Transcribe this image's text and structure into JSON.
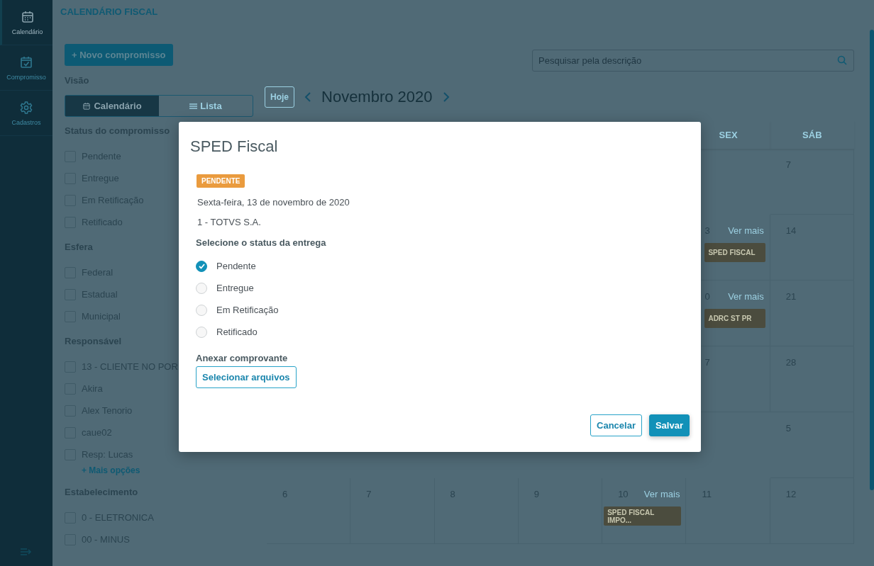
{
  "nav": {
    "items": [
      {
        "label": "Calendário",
        "selected": true
      },
      {
        "label": "Compromisso",
        "selected": false
      },
      {
        "label": "Cadastros",
        "selected": false
      }
    ]
  },
  "header": {
    "title": "CALENDÁRIO FISCAL"
  },
  "filters": {
    "new_button": "+ Novo compromisso",
    "view_label": "Visão",
    "view_options": [
      {
        "label": "Calendário",
        "selected": true
      },
      {
        "label": "Lista",
        "selected": false
      }
    ],
    "sections": [
      {
        "title": "Status do compromisso",
        "options": [
          {
            "label": "Pendente",
            "checked": false
          },
          {
            "label": "Entregue",
            "checked": false
          },
          {
            "label": "Em Retificação",
            "checked": false
          },
          {
            "label": "Retificado",
            "checked": false
          }
        ]
      },
      {
        "title": "Esfera",
        "options": [
          {
            "label": "Federal",
            "checked": false
          },
          {
            "label": "Estadual",
            "checked": false
          },
          {
            "label": "Municipal",
            "checked": false
          }
        ]
      },
      {
        "title": "Responsável",
        "options": [
          {
            "label": "13 - CLIENTE NO POR",
            "checked": false
          },
          {
            "label": "Akira",
            "checked": false
          },
          {
            "label": "Alex Tenorio",
            "checked": false
          },
          {
            "label": "caue02",
            "checked": false
          },
          {
            "label": "Resp: Lucas",
            "checked": false
          }
        ],
        "more": "+ Mais opções"
      },
      {
        "title": "Estabelecimento",
        "options": [
          {
            "label": "0 - ELETRONICA",
            "checked": false
          },
          {
            "label": "00 - MINUS",
            "checked": false
          }
        ]
      }
    ]
  },
  "search": {
    "placeholder": "Pesquisar pela descrição"
  },
  "calendar": {
    "today_button": "Hoje",
    "month": "Novembro 2020",
    "weekdays": [
      "SEX",
      "SÁB"
    ],
    "weeks": [
      {
        "days": [
          {
            "date": "7"
          }
        ]
      },
      {
        "days": [
          {
            "date": "3",
            "more": "Ver mais",
            "events": [
              "SPED FISCAL"
            ]
          },
          {
            "date": "14"
          }
        ]
      },
      {
        "days": [
          {
            "date": "0",
            "more": "Ver mais",
            "events": [
              "ADRC ST PR"
            ]
          },
          {
            "date": "21"
          }
        ]
      },
      {
        "days": [
          {
            "date": "7"
          },
          {
            "date": "28"
          }
        ]
      },
      {
        "days": [
          {
            "date": "5"
          }
        ]
      },
      {
        "days": [
          {
            "date": "6"
          },
          {
            "date": "7"
          },
          {
            "date": "8"
          },
          {
            "date": "9"
          },
          {
            "date": "10",
            "more": "Ver mais",
            "events": [
              "SPED FISCAL IMPO..."
            ]
          },
          {
            "date": "11"
          },
          {
            "date": "12"
          }
        ]
      }
    ]
  },
  "modal": {
    "title": "SPED Fiscal",
    "status_badge": "PENDENTE",
    "date": "Sexta-feira, 13 de novembro de 2020",
    "company": "1 - TOTVS S.A.",
    "status_label": "Selecione o status da entrega",
    "status_options": [
      {
        "label": "Pendente",
        "selected": true
      },
      {
        "label": "Entregue",
        "selected": false
      },
      {
        "label": "Em Retificação",
        "selected": false
      },
      {
        "label": "Retificado",
        "selected": false
      }
    ],
    "attach_label": "Anexar comprovante",
    "attach_button": "Selecionar arquivos",
    "buttons": [
      {
        "label": "Cancelar",
        "kind": "secondary"
      },
      {
        "label": "Salvar",
        "kind": "primary"
      }
    ]
  }
}
